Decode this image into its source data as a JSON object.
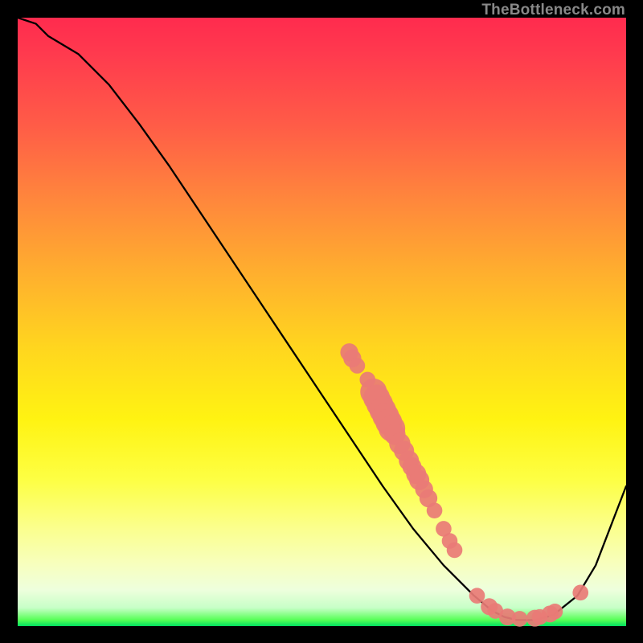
{
  "attribution": "TheBottleneck.com",
  "chart_data": {
    "type": "line",
    "title": "",
    "xlabel": "",
    "ylabel": "",
    "xlim": [
      0,
      100
    ],
    "ylim": [
      0,
      100
    ],
    "series": [
      {
        "name": "bottleneck-curve",
        "x": [
          0,
          3,
          5,
          10,
          15,
          20,
          25,
          30,
          35,
          40,
          45,
          50,
          55,
          60,
          65,
          70,
          75,
          78,
          80,
          82,
          85,
          88,
          92,
          95,
          100
        ],
        "y": [
          100,
          99,
          97,
          94,
          89,
          82.5,
          75.5,
          68,
          60.5,
          53,
          45.5,
          38,
          30.5,
          23,
          16,
          10,
          5,
          2.5,
          1.5,
          1,
          1,
          1.8,
          5,
          10,
          23
        ]
      }
    ],
    "scatter_points": {
      "name": "highlighted-points",
      "color": "#e97b76",
      "points": [
        {
          "x": 54.5,
          "y": 45.0,
          "r": 1.2
        },
        {
          "x": 55.0,
          "y": 44.0,
          "r": 1.2
        },
        {
          "x": 55.8,
          "y": 42.8,
          "r": 1.0
        },
        {
          "x": 57.5,
          "y": 40.5,
          "r": 1.0
        },
        {
          "x": 58.5,
          "y": 38.5,
          "r": 2.0
        },
        {
          "x": 59.0,
          "y": 37.5,
          "r": 2.0
        },
        {
          "x": 59.5,
          "y": 36.5,
          "r": 2.0
        },
        {
          "x": 60.0,
          "y": 35.5,
          "r": 2.0
        },
        {
          "x": 60.5,
          "y": 34.5,
          "r": 2.0
        },
        {
          "x": 61.0,
          "y": 33.5,
          "r": 2.0
        },
        {
          "x": 61.5,
          "y": 32.5,
          "r": 2.0
        },
        {
          "x": 62.0,
          "y": 31.5,
          "r": 1.5
        },
        {
          "x": 62.8,
          "y": 30.0,
          "r": 1.5
        },
        {
          "x": 63.5,
          "y": 28.8,
          "r": 1.4
        },
        {
          "x": 64.3,
          "y": 27.2,
          "r": 1.4
        },
        {
          "x": 64.8,
          "y": 26.2,
          "r": 1.3
        },
        {
          "x": 65.5,
          "y": 25.0,
          "r": 1.4
        },
        {
          "x": 66.0,
          "y": 24.0,
          "r": 1.4
        },
        {
          "x": 66.8,
          "y": 22.5,
          "r": 1.2
        },
        {
          "x": 67.5,
          "y": 21.0,
          "r": 1.2
        },
        {
          "x": 68.5,
          "y": 19.0,
          "r": 1.0
        },
        {
          "x": 70.0,
          "y": 16.0,
          "r": 1.0
        },
        {
          "x": 71.0,
          "y": 14.0,
          "r": 1.0
        },
        {
          "x": 71.8,
          "y": 12.5,
          "r": 1.0
        },
        {
          "x": 75.5,
          "y": 5.0,
          "r": 1.0
        },
        {
          "x": 77.5,
          "y": 3.2,
          "r": 1.1
        },
        {
          "x": 78.5,
          "y": 2.5,
          "r": 1.0
        },
        {
          "x": 80.5,
          "y": 1.5,
          "r": 1.1
        },
        {
          "x": 82.5,
          "y": 1.2,
          "r": 1.0
        },
        {
          "x": 85.0,
          "y": 1.3,
          "r": 1.1
        },
        {
          "x": 85.8,
          "y": 1.5,
          "r": 1.0
        },
        {
          "x": 87.5,
          "y": 2.0,
          "r": 1.1
        },
        {
          "x": 88.3,
          "y": 2.4,
          "r": 1.0
        },
        {
          "x": 92.5,
          "y": 5.5,
          "r": 1.0
        }
      ]
    }
  }
}
